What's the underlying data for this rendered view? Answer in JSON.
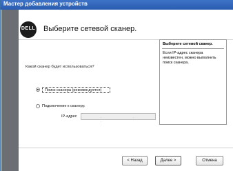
{
  "window": {
    "title": "Мастер добавления устройств"
  },
  "logo": {
    "text": "DELL"
  },
  "header": {
    "title": "Выберите сетевой сканер."
  },
  "info": {
    "title": "Выберите сетевой сканер.",
    "body": "Если IP-адрес сканера неизвестен, можно выполнить поиск сканера."
  },
  "form": {
    "question": "Какой сканер будет использоваться?",
    "option_search": "Поиск сканера (рекомендуется)",
    "option_connect": "Подключение к сканеру.",
    "ip_label": "IP-адрес",
    "ip_value": ". . ."
  },
  "buttons": {
    "back": "< Назад",
    "next": "Далее >",
    "cancel": "Отмена"
  }
}
